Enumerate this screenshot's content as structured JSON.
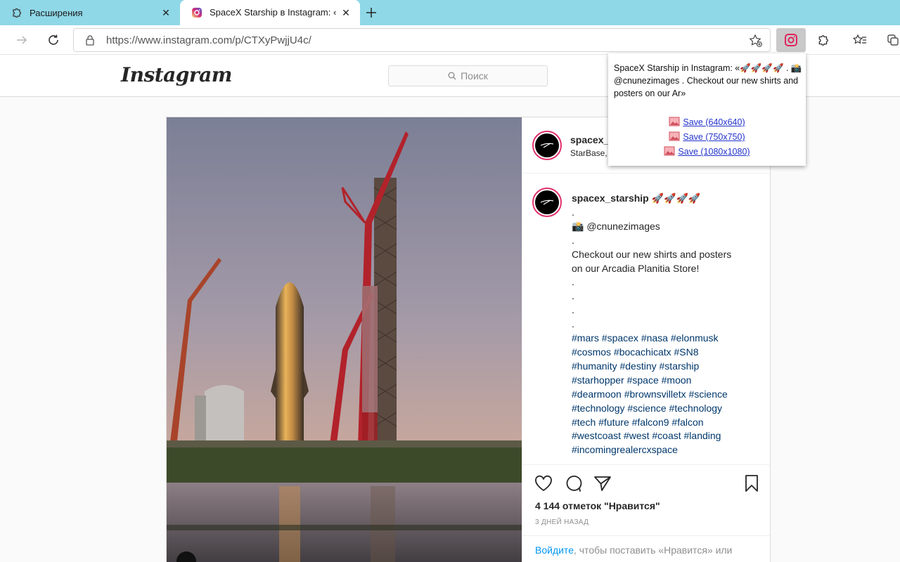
{
  "browser": {
    "tabs": [
      {
        "title": "Расширения",
        "icon": "puzzle-icon",
        "active": false
      },
      {
        "title": "SpaceX Starship в Instagram: «🚀",
        "icon": "instagram-icon",
        "active": true
      }
    ],
    "close_glyph": "✕",
    "url": "https://www.instagram.com/p/CTXyPwjjU4c/"
  },
  "instagram": {
    "logo": "Instagram",
    "search_placeholder": "Поиск",
    "login_link_fragment": "ся",
    "post": {
      "username": "spacex_s",
      "location": "StarBase,",
      "caption": {
        "username": "spacex_starship 🚀🚀🚀🚀",
        "lines": [
          ".",
          "📸 @cnunezimages",
          ".",
          "Checkout our new shirts and posters",
          "on our Arcadia Planitia Store!",
          ".",
          ".",
          ".",
          "."
        ],
        "hashtag_lines": [
          "#mars #spacex #nasa #elonmusk",
          "#cosmos #bocachicatx #SN8",
          "#humanity #destiny #starship",
          "#starhopper #space #moon",
          "#dearmoon #brownsvilletx #science",
          "#technology #science #technology",
          "#tech #future #falcon9 #falcon",
          "#westcoast #west #coast #landing",
          "#incomingrealercxspace"
        ]
      },
      "likes": "4 144 отметок \"Нравится\"",
      "date": "3 ДНЕЙ НАЗАД",
      "login_prompt_link": "Войдите",
      "login_prompt_rest": ", чтобы поставить «Нравится» или"
    }
  },
  "popup": {
    "title": "SpaceX Starship in Instagram: «🚀🚀🚀🚀 . 📸 @cnunezimages . Checkout our new shirts and posters on our Ar»",
    "links": [
      "Save (640x640)",
      "Save (750x750)",
      "Save (1080x1080)"
    ]
  },
  "colors": {
    "tabstrip": "#8fd8e8",
    "instagram_blue": "#0095f6",
    "hashtag": "#00376b",
    "popup_link": "#2233cc"
  }
}
